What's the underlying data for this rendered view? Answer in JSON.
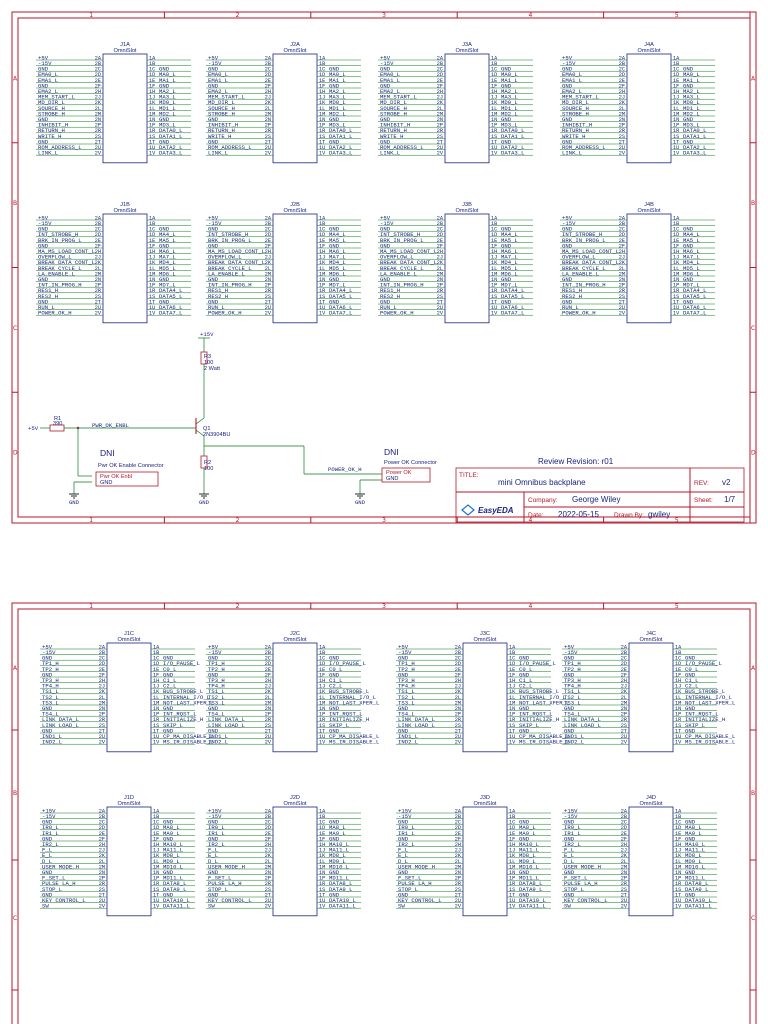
{
  "zones_top": [
    "1",
    "2",
    "3",
    "4",
    "5"
  ],
  "zones_side": [
    "A",
    "B",
    "C",
    "D"
  ],
  "sheet1": {
    "row1": [
      {
        "ref": "J1A"
      },
      {
        "ref": "J2A"
      },
      {
        "ref": "J3A"
      },
      {
        "ref": "J4A"
      }
    ],
    "row2": [
      {
        "ref": "J1B"
      },
      {
        "ref": "J2B"
      },
      {
        "ref": "J3B"
      },
      {
        "ref": "J4B"
      }
    ],
    "conn_value": "OmniSlot",
    "rowA_left": [
      [
        "+5V",
        "2A"
      ],
      [
        "-15V",
        "2B"
      ],
      [
        "GND",
        "2C"
      ],
      [
        "EMA0_L",
        "2D"
      ],
      [
        "EMA1_L",
        "2E"
      ],
      [
        "GND",
        "2F"
      ],
      [
        "EMA2_L",
        "2H"
      ],
      [
        "MEM_START_L",
        "2J"
      ],
      [
        "MD_DIR_L",
        "2K"
      ],
      [
        "SOURCE_H",
        "2L"
      ],
      [
        "STROBE_H",
        "2M"
      ],
      [
        "GND",
        "2N"
      ],
      [
        "INHIBIT_H",
        "2P"
      ],
      [
        "RETURN_H",
        "2R"
      ],
      [
        "WRITE_H",
        "2S"
      ],
      [
        "GND",
        "2T"
      ],
      [
        "ROM_ADDRESS_L",
        "2U"
      ],
      [
        "LINK_L",
        "2V"
      ]
    ],
    "rowA_right": [
      [
        "1A",
        ""
      ],
      [
        "1B",
        ""
      ],
      [
        "1C",
        "GND"
      ],
      [
        "1D",
        "MA0_L"
      ],
      [
        "1E",
        "MA1_L"
      ],
      [
        "1F",
        "GND"
      ],
      [
        "1H",
        "MA2_L"
      ],
      [
        "1J",
        "MA3_L"
      ],
      [
        "1K",
        "MD0_L"
      ],
      [
        "1L",
        "MD1_L"
      ],
      [
        "1M",
        "MD2_L"
      ],
      [
        "1N",
        "GND"
      ],
      [
        "1P",
        "MD3_L"
      ],
      [
        "1R",
        "DATA0_L"
      ],
      [
        "1S",
        "DATA1_L"
      ],
      [
        "1T",
        "GND"
      ],
      [
        "1U",
        "DATA2_L"
      ],
      [
        "1V",
        "DATA3_L"
      ]
    ],
    "rowB_left": [
      [
        "+5V",
        "2A"
      ],
      [
        "-15V",
        "2B"
      ],
      [
        "GND",
        "2C"
      ],
      [
        "INT_STROBE_H",
        "2D"
      ],
      [
        "BRK_IN_PROG_L",
        "2E"
      ],
      [
        "GND",
        "2F"
      ],
      [
        "MA_MS_LOAD_CONT_L",
        "2H"
      ],
      [
        "OVERFLOW_L",
        "2J"
      ],
      [
        "BREAK DATA CONT_L",
        "2K"
      ],
      [
        "BREAK CYCLE_L",
        "2L"
      ],
      [
        "LA_ENABLE_L",
        "2M"
      ],
      [
        "GND",
        "2N"
      ],
      [
        "INT_IN_PROG_H",
        "2P"
      ],
      [
        "RES1_H",
        "2R"
      ],
      [
        "RES2_H",
        "2S"
      ],
      [
        "GND",
        "2T"
      ],
      [
        "RUN_L",
        "2U"
      ],
      [
        "POWER_OK_H",
        "2V"
      ]
    ],
    "rowB_right": [
      [
        "1A",
        ""
      ],
      [
        "1B",
        ""
      ],
      [
        "1C",
        "GND"
      ],
      [
        "1D",
        "MA4_L"
      ],
      [
        "1E",
        "MA5_L"
      ],
      [
        "1F",
        "GND"
      ],
      [
        "1H",
        "MA6_L"
      ],
      [
        "1J",
        "MA7_L"
      ],
      [
        "1K",
        "MD4_L"
      ],
      [
        "1L",
        "MD5_L"
      ],
      [
        "1M",
        "MD6_L"
      ],
      [
        "1N",
        "GND"
      ],
      [
        "1P",
        "MD7_L"
      ],
      [
        "1R",
        "DATA4_L"
      ],
      [
        "1S",
        "DATA5_L"
      ],
      [
        "1T",
        "GND"
      ],
      [
        "1U",
        "DATA6_L"
      ],
      [
        "1V",
        "DATA7_L"
      ]
    ],
    "circuit": {
      "vcc": "+15V",
      "vin": "+5V",
      "r1_ref": "R1",
      "r1_val": "390",
      "net_pwr": "PWR_OK_ENBL",
      "r3_ref": "R3",
      "r3_val": "100",
      "r3_watt": "2 Watt",
      "q_ref": "Q1",
      "q_val": "2N3904BU",
      "r2_ref": "R2",
      "r2_val": "100",
      "dni1": "DNI",
      "conn1_title": "Pwr OK Enable Connector",
      "conn1_pin1": "Pwr OK Enbl",
      "conn1_pin2": "GND",
      "dni2": "DNI",
      "conn2_title": "Power OK Connector",
      "conn2_pin1": "Power OK",
      "conn2_pin2": "GND",
      "net_pok": "POWER_OK_H",
      "gnd": "GND"
    },
    "title_block": {
      "review": "Review Revision: r01",
      "title_label": "TITLE:",
      "title": "mini Omnibus backplane",
      "rev_label": "REV:",
      "rev": "v2",
      "company_label": "Company:",
      "company": "George Wiley",
      "sheet_label": "Sheet:",
      "sheet": "1/7",
      "date_label": "Date:",
      "date": "2022-05-15",
      "drawn_label": "Drawn By:",
      "drawn": "gwiley",
      "logo": "EasyEDA"
    }
  },
  "sheet2": {
    "row1": [
      {
        "ref": "J1C"
      },
      {
        "ref": "J2C"
      },
      {
        "ref": "J3C"
      },
      {
        "ref": "J4C"
      }
    ],
    "row2": [
      {
        "ref": "J1D"
      },
      {
        "ref": "J2D"
      },
      {
        "ref": "J3D"
      },
      {
        "ref": "J4D"
      }
    ],
    "conn_value": "OmniSlot",
    "rowC_left": [
      [
        "+5V",
        "2A"
      ],
      [
        "-15V",
        "2B"
      ],
      [
        "GND",
        "2C"
      ],
      [
        "TP1_H",
        "2D"
      ],
      [
        "TP2_H",
        "2E"
      ],
      [
        "GND",
        "2F"
      ],
      [
        "TP3_H",
        "2H"
      ],
      [
        "TP4_H",
        "2J"
      ],
      [
        "TS1_L",
        "2K"
      ],
      [
        "TS2_L",
        "2L"
      ],
      [
        "TS3_L",
        "2M"
      ],
      [
        "GND",
        "2N"
      ],
      [
        "TS4_L",
        "2P"
      ],
      [
        "LINK DATA_L",
        "2R"
      ],
      [
        "LINK LOAD_L",
        "2S"
      ],
      [
        "GND",
        "2T"
      ],
      [
        "IND1_L",
        "2U"
      ],
      [
        "IND2_L",
        "2V"
      ]
    ],
    "rowC_right": [
      [
        "1A",
        ""
      ],
      [
        "1B",
        ""
      ],
      [
        "1C",
        "GND"
      ],
      [
        "1D",
        "I/O_PAUSE_L"
      ],
      [
        "1E",
        "C0_L"
      ],
      [
        "1F",
        "GND"
      ],
      [
        "1H",
        "C1_L"
      ],
      [
        "1J",
        "C2_L"
      ],
      [
        "1K",
        "BUS_STROBE_L"
      ],
      [
        "1L",
        "INTERNAL_I/O_L"
      ],
      [
        "1M",
        "NOT_LAST_XFER_L"
      ],
      [
        "1N",
        "GND"
      ],
      [
        "1P",
        "INT_RQST_L"
      ],
      [
        "1R",
        "INITIALIZE_H"
      ],
      [
        "1S",
        "SKIP_L"
      ],
      [
        "1T",
        "GND"
      ],
      [
        "1U",
        "CP_MA_DISABLE_L"
      ],
      [
        "1V",
        "MS_IR_DISABLE_L"
      ]
    ],
    "rowD_left": [
      [
        "+15V",
        "2A"
      ],
      [
        "-15V",
        "2B"
      ],
      [
        "GND",
        "2C"
      ],
      [
        "IR0_L",
        "2D"
      ],
      [
        "IR1_L",
        "2E"
      ],
      [
        "GND",
        "2F"
      ],
      [
        "IR2_L",
        "2H"
      ],
      [
        "F_L",
        "2J"
      ],
      [
        "E_L",
        "2K"
      ],
      [
        "D_L",
        "2L"
      ],
      [
        "USER MODE_H",
        "2M"
      ],
      [
        "GND",
        "2N"
      ],
      [
        "F_SET_L",
        "2P"
      ],
      [
        "PULSE LA_H",
        "2R"
      ],
      [
        "STOP_L",
        "2S"
      ],
      [
        "GND",
        "2T"
      ],
      [
        "KEY CONTROL_L",
        "2U"
      ],
      [
        "SW",
        "2V"
      ]
    ],
    "rowD_right": [
      [
        "1A",
        ""
      ],
      [
        "1B",
        ""
      ],
      [
        "1C",
        "GND"
      ],
      [
        "1D",
        "MA8_L"
      ],
      [
        "1E",
        "MA9_L"
      ],
      [
        "1F",
        "GND"
      ],
      [
        "1H",
        "MA10_L"
      ],
      [
        "1J",
        "MA11_L"
      ],
      [
        "1K",
        "MD8_L"
      ],
      [
        "1L",
        "MD9_L"
      ],
      [
        "1M",
        "MD10_L"
      ],
      [
        "1N",
        "GND"
      ],
      [
        "1P",
        "MD11_L"
      ],
      [
        "1R",
        "DATA8_L"
      ],
      [
        "1S",
        "DATA9_L"
      ],
      [
        "1T",
        "GND"
      ],
      [
        "1U",
        "DATA10_L"
      ],
      [
        "1V",
        "DATA11_L"
      ]
    ]
  }
}
